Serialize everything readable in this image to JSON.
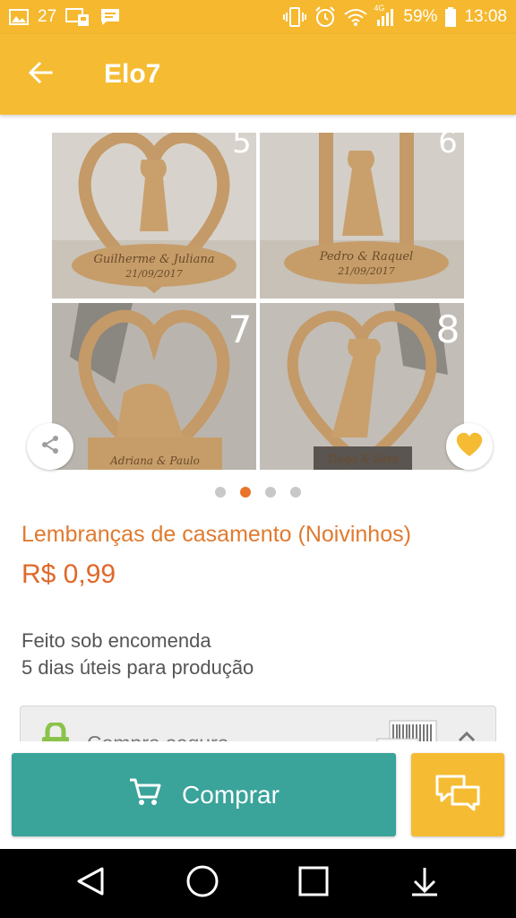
{
  "status_bar": {
    "notification_count": "27",
    "battery_percent": "59%",
    "time": "13:08",
    "network_label": "4G",
    "icons": [
      "image-icon",
      "mail-icon",
      "message-icon",
      "vibrate-icon",
      "alarm-icon",
      "wifi-icon",
      "signal-icon",
      "battery-icon"
    ]
  },
  "app_bar": {
    "title": "Elo7",
    "back_icon": "arrow-left-icon"
  },
  "gallery": {
    "tile_numbers": [
      "5",
      "6",
      "7",
      "8"
    ],
    "engravings": [
      "Guilherme & Juliana",
      "Pedro & Raquel",
      "Adriana & Paulo",
      "Tiago & Sara"
    ],
    "engraved_date": "21/09/2017",
    "share_icon": "share-icon",
    "favorite_icon": "heart-icon",
    "page_count": 4,
    "active_page": 1
  },
  "product": {
    "title": "Lembranças de casamento (Noivinhos)",
    "price": "R$ 0,99",
    "production_type": "Feito sob encomenda",
    "production_time": "5 dias úteis para produção"
  },
  "secure_purchase": {
    "label": "Compra segura",
    "icon": "lock-icon"
  },
  "actions": {
    "buy_label": "Comprar",
    "buy_icon": "cart-icon",
    "chat_icon": "chat-icon"
  },
  "colors": {
    "primary_yellow": "#f5bc33",
    "accent_orange": "#e07a2f",
    "buy_teal": "#3aa39a"
  },
  "nav_bar": {
    "icons": [
      "back-triangle-icon",
      "home-circle-icon",
      "recents-square-icon",
      "download-arrow-icon"
    ]
  }
}
